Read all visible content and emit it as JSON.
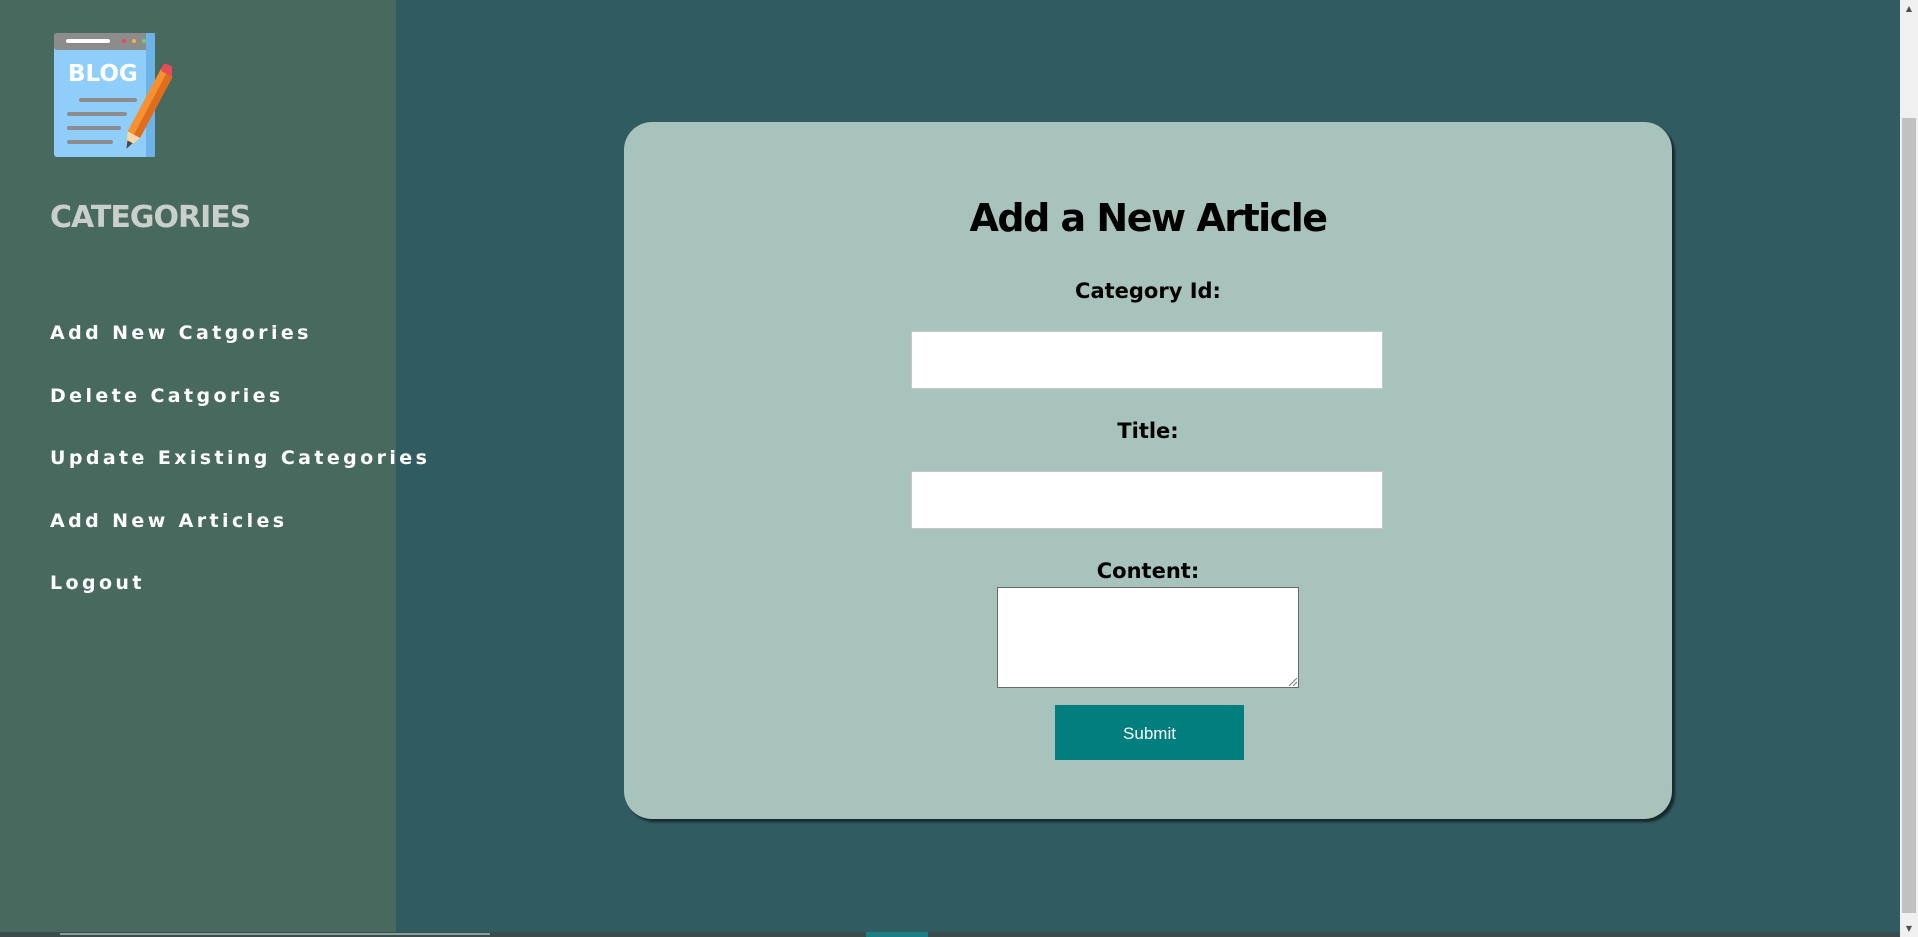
{
  "sidebar": {
    "logo_text": "BLOG",
    "title": "CATEGORIES",
    "items": [
      {
        "label": "Add New Catgories"
      },
      {
        "label": "Delete Catgories"
      },
      {
        "label": "Update Existing Categories"
      },
      {
        "label": "Add New Articles"
      },
      {
        "label": "Logout"
      }
    ]
  },
  "form": {
    "title": "Add a New Article",
    "category_label": "Category Id:",
    "title_label": "Title:",
    "content_label": "Content:",
    "category_value": "",
    "title_value": "",
    "content_value": "",
    "submit_label": "Submit"
  },
  "colors": {
    "page_background": "#305b60",
    "sidebar_background": "#486a5e",
    "card_background": "#a7c3bc",
    "submit_button": "#017f7e"
  },
  "icons": {
    "logo": "blog-notepad-pencil-icon",
    "scroll_up": "scroll-up-arrow-icon",
    "scroll_down": "scroll-down-arrow-icon"
  }
}
